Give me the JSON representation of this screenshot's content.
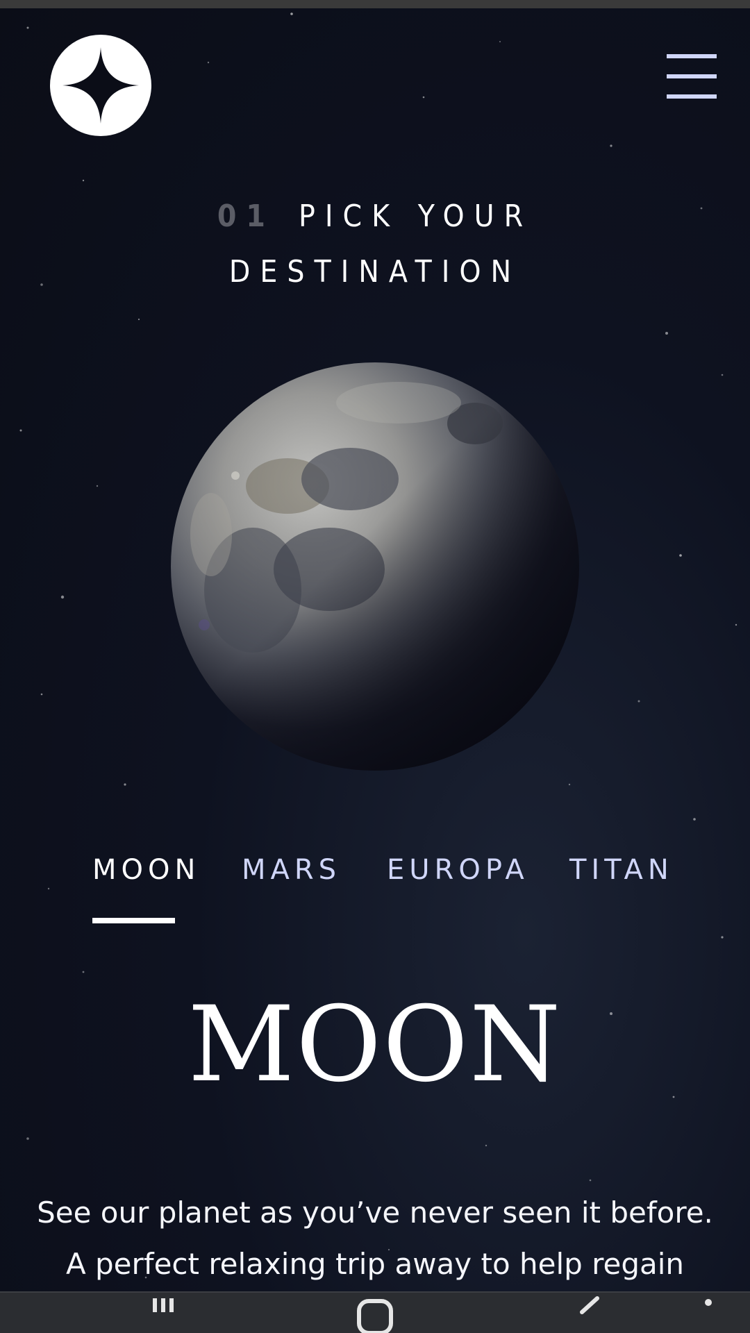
{
  "header": {
    "logo_icon": "star-logo-icon",
    "menu_icon": "hamburger-menu-icon"
  },
  "heading": {
    "number": "01",
    "title_line1": "PICK YOUR",
    "title_line2": "DESTINATION"
  },
  "destination_image": {
    "icon": "moon-image"
  },
  "tabs": [
    {
      "label": "MOON",
      "active": true
    },
    {
      "label": "MARS",
      "active": false
    },
    {
      "label": "EUROPA",
      "active": false
    },
    {
      "label": "TITAN",
      "active": false
    }
  ],
  "destination": {
    "name": "MOON",
    "description_line1": "See our planet as you’ve never seen it before.",
    "description_line2": "A perfect relaxing trip away to help regain"
  },
  "navbar": {
    "recent_icon": "recent-apps-icon",
    "home_icon": "home-icon",
    "back_icon": "back-icon",
    "more_icon": "more-icon"
  },
  "colors": {
    "background": "#0b0d17",
    "tab_inactive": "#d0d6f9",
    "heading_number": "#5b5d66",
    "accent": "#ffffff"
  }
}
